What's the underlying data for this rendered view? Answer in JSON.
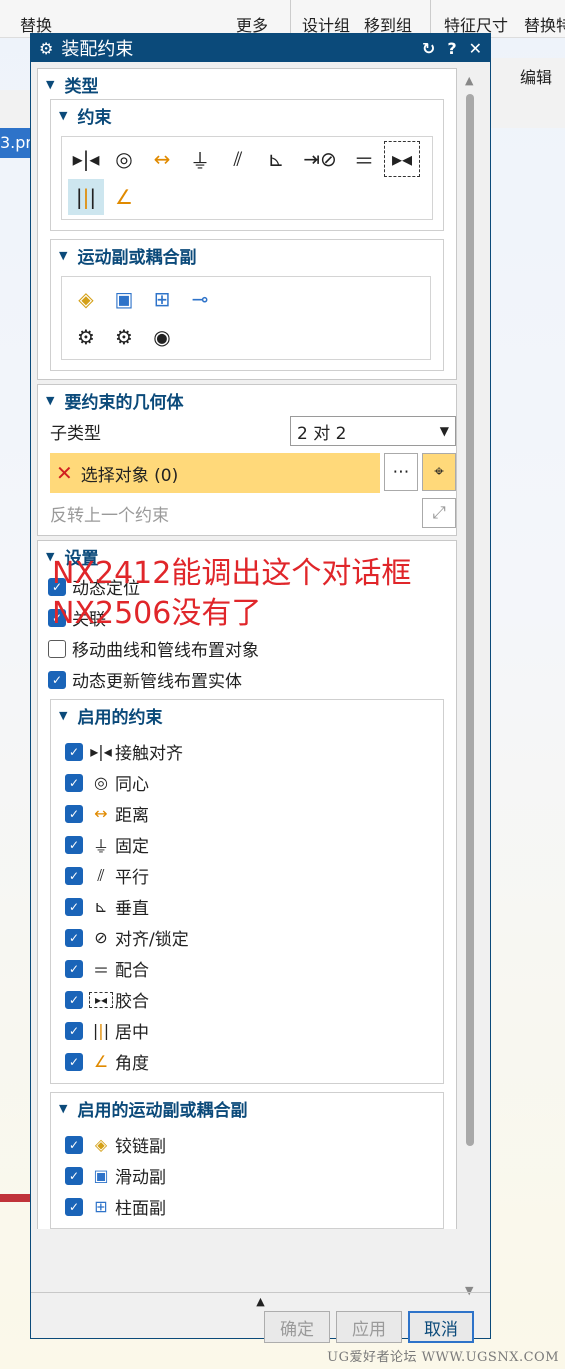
{
  "app": {
    "toolbar": {
      "replace": "替换",
      "more": "更多",
      "design_group": "设计组",
      "move_to_group": "移到组",
      "feature_dim": "特征尺寸",
      "replace2": "替换特"
    },
    "ribbon_edit": "编辑",
    "file_tab": "3.pr",
    "watermark": "UG爱好者论坛 WWW.UGSNX.COM"
  },
  "dialog": {
    "title": "装配约束",
    "type_section": "类型",
    "constraint_section": "约束",
    "constraint_icons": [
      "touch-align-icon",
      "concentric-icon",
      "distance-icon",
      "fix-icon",
      "parallel-icon",
      "perpendicular-icon",
      "align-lock-icon",
      "fit-icon",
      "bond-icon",
      "center-icon",
      "angle-icon"
    ],
    "selected_constraint": "center-icon",
    "motion_section": "运动副或耦合副",
    "motion_icons": [
      "hinge-joint-icon",
      "slider-joint-icon",
      "cylindrical-joint-icon",
      "ball-joint-icon",
      "gear-coupler-icon",
      "rack-pinion-icon",
      "cable-coupler-icon"
    ],
    "geometry_section": "要约束的几何体",
    "subtype_label": "子类型",
    "subtype_value": "2 对 2",
    "select_object": "选择对象 (0)",
    "reverse_label": "反转上一个约束",
    "settings_section": "设置",
    "settings": [
      {
        "label": "动态定位",
        "checked": true
      },
      {
        "label": "关联",
        "checked": true
      },
      {
        "label": "移动曲线和管线布置对象",
        "checked": false
      },
      {
        "label": "动态更新管线布置实体",
        "checked": true
      }
    ],
    "enabled_constraints_section": "启用的约束",
    "enabled_constraints": [
      {
        "label": "接触对齐",
        "icon": "touch-align-icon"
      },
      {
        "label": "同心",
        "icon": "concentric-icon"
      },
      {
        "label": "距离",
        "icon": "distance-icon"
      },
      {
        "label": "固定",
        "icon": "fix-icon"
      },
      {
        "label": "平行",
        "icon": "parallel-icon"
      },
      {
        "label": "垂直",
        "icon": "perpendicular-icon"
      },
      {
        "label": "对齐/锁定",
        "icon": "align-lock-icon"
      },
      {
        "label": "配合",
        "icon": "fit-icon"
      },
      {
        "label": "胶合",
        "icon": "bond-icon"
      },
      {
        "label": "居中",
        "icon": "center-icon"
      },
      {
        "label": "角度",
        "icon": "angle-icon"
      }
    ],
    "enabled_motion_section": "启用的运动副或耦合副",
    "enabled_motion": [
      {
        "label": "铰链副",
        "icon": "hinge-joint-icon"
      },
      {
        "label": "滑动副",
        "icon": "slider-joint-icon"
      },
      {
        "label": "柱面副",
        "icon": "cylindrical-joint-icon"
      }
    ],
    "ok": "确定",
    "apply": "应用",
    "cancel": "取消"
  },
  "annotation": {
    "line1": "NX2412能调出这个对话框",
    "line2": "NX2506没有了"
  },
  "colors": {
    "title_bar": "#0b4a7a",
    "selection_yellow": "#ffd97a",
    "annotation_red": "#e0262a",
    "checkbox_blue": "#1a64b8"
  }
}
